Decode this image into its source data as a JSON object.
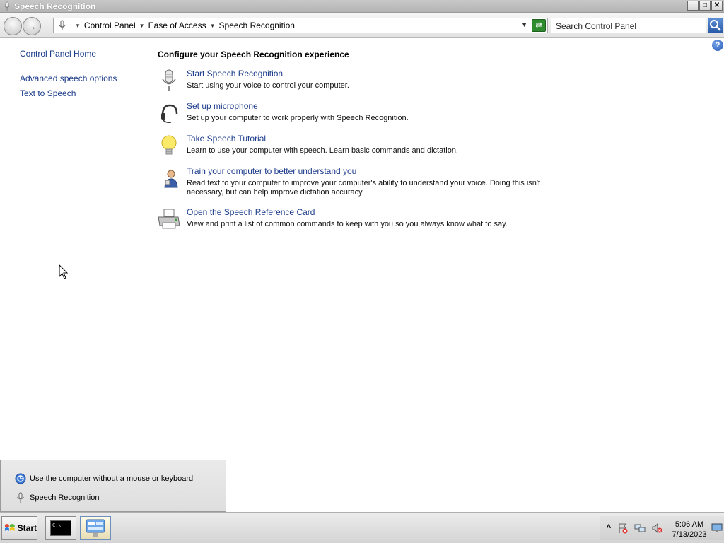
{
  "window": {
    "title": "Speech Recognition",
    "buttons": {
      "minimize": "_",
      "maximize": "□",
      "close": "✕"
    }
  },
  "addressbar": {
    "breadcrumbs": [
      "Control Panel",
      "Ease of Access",
      "Speech Recognition"
    ],
    "search_placeholder": "Search Control Panel"
  },
  "help_glyph": "?",
  "sidebar": {
    "home": "Control Panel Home",
    "items": [
      {
        "label": "Advanced speech options"
      },
      {
        "label": "Text to Speech"
      }
    ]
  },
  "main": {
    "heading": "Configure your Speech Recognition experience",
    "tasks": [
      {
        "icon": "microphone-icon",
        "link": "Start Speech Recognition",
        "description": "Start using your voice to control your computer."
      },
      {
        "icon": "headset-icon",
        "link": "Set up microphone",
        "description": "Set up your computer to work properly with Speech Recognition."
      },
      {
        "icon": "lightbulb-icon",
        "link": "Take Speech Tutorial",
        "description": "Learn to use your computer with speech.  Learn basic commands and dictation."
      },
      {
        "icon": "person-icon",
        "link": "Train your computer to better understand you",
        "description": "Read text to your computer to improve your computer's ability to understand your voice.  Doing this isn't necessary, but can help improve dictation accuracy."
      },
      {
        "icon": "printer-icon",
        "link": "Open the Speech Reference Card",
        "description": "View and print a list of common commands to keep with you so you always know what to say."
      }
    ]
  },
  "popup": {
    "items": [
      {
        "icon": "ease-of-access-icon",
        "label": "Use the computer without a mouse or keyboard"
      },
      {
        "icon": "microphone-icon",
        "label": "Speech Recognition"
      }
    ]
  },
  "taskbar": {
    "start_label": "Start",
    "cmd_label": "C:\\",
    "clock": {
      "time": "5:06 AM",
      "date": "7/13/2023"
    }
  }
}
